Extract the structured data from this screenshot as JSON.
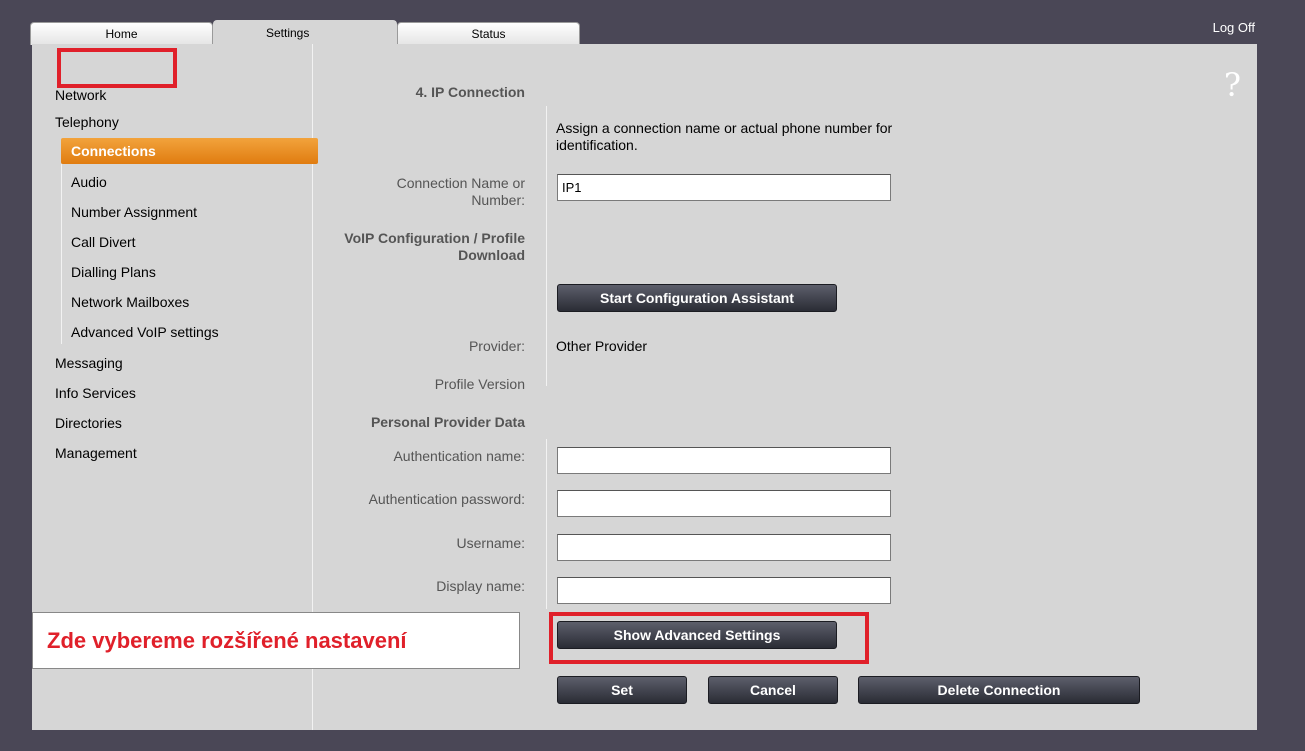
{
  "tabs": [
    {
      "label": "Home"
    },
    {
      "label": "Settings"
    },
    {
      "label": "Status"
    }
  ],
  "header": {
    "logoff": "Log Off",
    "help_glyph": "?"
  },
  "sidebar": {
    "items": [
      {
        "label": "Network"
      },
      {
        "label": "Telephony"
      },
      {
        "label": "Connections"
      },
      {
        "label": "Audio"
      },
      {
        "label": "Number Assignment"
      },
      {
        "label": "Call Divert"
      },
      {
        "label": "Dialling Plans"
      },
      {
        "label": "Network Mailboxes"
      },
      {
        "label": "Advanced VoIP settings"
      },
      {
        "label": "Messaging"
      },
      {
        "label": "Info Services"
      },
      {
        "label": "Directories"
      },
      {
        "label": "Management"
      }
    ]
  },
  "main": {
    "section_title": "4. IP Connection",
    "description": "Assign a connection name or actual phone number for identification.",
    "connection_name_label": "Connection Name or Number:",
    "connection_name_value": "IP1",
    "voip_config_label": "VoIP Configuration / Profile Download",
    "start_assistant_label": "Start Configuration Assistant",
    "provider_label": "Provider:",
    "provider_value": "Other Provider",
    "profile_version_label": "Profile Version",
    "personal_provider_label": "Personal Provider Data",
    "auth_name_label": "Authentication name:",
    "auth_name_value": "",
    "auth_password_label": "Authentication password:",
    "auth_password_value": "",
    "username_label": "Username:",
    "username_value": "",
    "display_name_label": "Display name:",
    "display_name_value": "",
    "show_advanced_label": "Show Advanced Settings",
    "set_label": "Set",
    "cancel_label": "Cancel",
    "delete_label": "Delete Connection"
  },
  "annotation": {
    "text": "Zde vybereme rozšířené nastavení"
  },
  "colors": {
    "accent": "#e8891f",
    "annotation_red": "#e0202a",
    "background": "#4a4756",
    "panel": "#d6d6d6"
  }
}
